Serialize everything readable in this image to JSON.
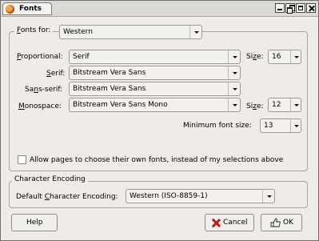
{
  "window": {
    "title": "Fonts"
  },
  "fonts_for": {
    "label_prefix": "",
    "label_mnemonic": "F",
    "label_rest": "onts for:",
    "value": "Western"
  },
  "fonts": {
    "proportional": {
      "label_mnemonic": "P",
      "label_rest": "roportional:",
      "value": "Serif"
    },
    "serif": {
      "label_pre": "",
      "label_mnemonic": "S",
      "label_rest": "erif:",
      "value": "Bitstream Vera Sans"
    },
    "sans_serif": {
      "label_pre": "Sa",
      "label_mnemonic": "n",
      "label_rest": "s-serif:",
      "value": "Bitstream Vera Sans"
    },
    "monospace": {
      "label_mnemonic": "M",
      "label_rest": "onospace:",
      "value": "Bitstream Vera Sans Mono"
    },
    "size_label_pre": "Si",
    "size_label_mnemonic": "z",
    "size_label_rest": "e:",
    "proportional_size": "16",
    "monospace_size": "12",
    "min_size_label": "Minimum font size:",
    "min_size_value": "13"
  },
  "allow_pages": {
    "label": "Allow pages to choose their own fonts, instead of my selections above",
    "checked": false
  },
  "encoding": {
    "group_title": "Character Encoding",
    "label_pre": "Default ",
    "label_mnemonic": "C",
    "label_rest": "haracter Encoding:",
    "value": "Western (ISO-8859-1)"
  },
  "buttons": {
    "help": "Help",
    "cancel": "Cancel",
    "ok": "OK"
  },
  "colors": {
    "dialog_bg": "#efebe7",
    "cancel_icon": "#b41d1d"
  }
}
